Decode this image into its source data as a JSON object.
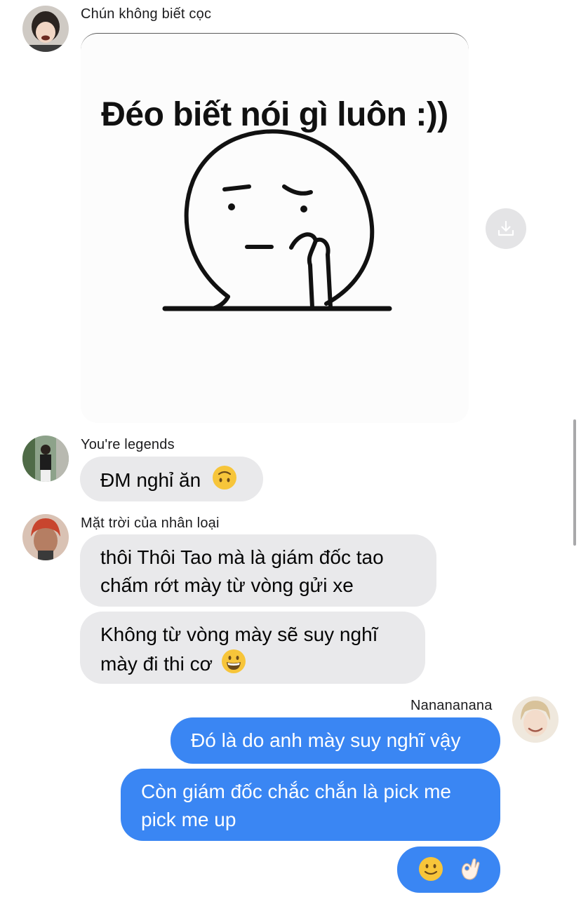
{
  "colors": {
    "incoming_bubble": "#e9e9eb",
    "outgoing_bubble": "#3a86f3",
    "background": "#ffffff"
  },
  "messages": [
    {
      "sender": "Chún không biết cọc",
      "type": "image",
      "meme_caption": "Đéo biết nói gì luôn :))",
      "avatar_icon": "person-avatar-icon"
    },
    {
      "sender": "You're legends",
      "text": "ĐM nghỉ ăn",
      "emoji": "upside-down-face-emoji"
    },
    {
      "sender": "Mặt trời của nhân loại",
      "lines": [
        "thôi Thôi Tao mà là giám đốc tao",
        "chấm rớt mày từ vòng gửi xe"
      ]
    },
    {
      "lines": [
        "Không từ vòng mày sẽ suy nghĩ",
        "mày đi thi cơ"
      ],
      "emoji": "grinning-face-emoji"
    },
    {
      "sender": "Nanananana",
      "text": "Đó là do anh mày suy nghĩ vậy",
      "outgoing": true
    },
    {
      "lines": [
        "Còn giám đốc chắc chắn là pick me",
        "pick me up"
      ],
      "outgoing": true
    },
    {
      "emojis": [
        "slightly-smiling-face-emoji",
        "ok-hand-emoji"
      ],
      "outgoing": true
    }
  ],
  "download_icon": "download-icon"
}
